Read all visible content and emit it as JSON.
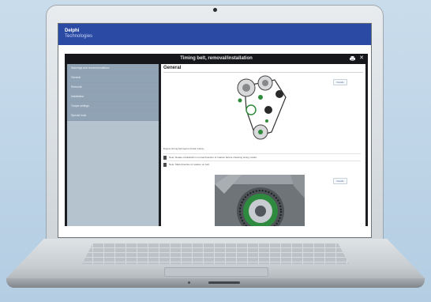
{
  "brand": {
    "line1": "Delphi",
    "line2": "Technologies"
  },
  "window": {
    "title": "Timing belt, removal/installation"
  },
  "icons": {
    "print": "printer-icon",
    "close": "close-icon"
  },
  "sidebar": {
    "items": [
      {
        "label": "Warnings and recommendations"
      },
      {
        "label": "General"
      },
      {
        "label": "Removal"
      },
      {
        "label": "Installation"
      },
      {
        "label": "Torque settings"
      },
      {
        "label": "Special tools"
      }
    ]
  },
  "content": {
    "heading": "General",
    "details_label": "Details",
    "description": "Engine timing belt layout shown below.",
    "steps": [
      {
        "text": "Note: Rotate crankshaft in normal direction of rotation before checking timing marks."
      },
      {
        "text": "Note: Mark direction of rotation on belt."
      }
    ]
  },
  "colors": {
    "brand_blue": "#2b4aa4",
    "sidebar_item": "#8fa3b5"
  }
}
